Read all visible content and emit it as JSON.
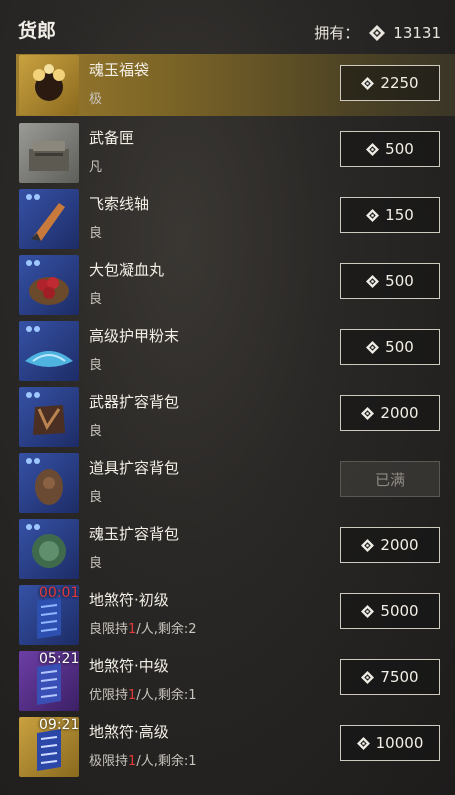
{
  "header": {
    "title": "货郎",
    "own_label": "拥有：",
    "own_amount": "13131"
  },
  "items": [
    {
      "name": "魂玉福袋",
      "quality": "极",
      "price": "2250",
      "thumb": "q-gold",
      "featured": true
    },
    {
      "name": "武备匣",
      "quality": "凡",
      "price": "500",
      "thumb": "q-grey"
    },
    {
      "name": "飞索线轴",
      "quality": "良",
      "price": "150",
      "thumb": "q-blue"
    },
    {
      "name": "大包凝血丸",
      "quality": "良",
      "price": "500",
      "thumb": "q-blue"
    },
    {
      "name": "高级护甲粉末",
      "quality": "良",
      "price": "500",
      "thumb": "q-blue"
    },
    {
      "name": "武器扩容背包",
      "quality": "良",
      "price": "2000",
      "thumb": "q-blue"
    },
    {
      "name": "道具扩容背包",
      "quality": "良",
      "price": "已满",
      "thumb": "q-blue",
      "full": true
    },
    {
      "name": "魂玉扩容背包",
      "quality": "良",
      "price": "2000",
      "thumb": "q-blue"
    },
    {
      "name": "地煞符·初级",
      "quality": "良",
      "limit_prefix": "限持",
      "limit_num": "1",
      "limit_suffix": "/人,剩余:2",
      "price": "5000",
      "thumb": "q-blue",
      "timer": "00:01",
      "timer_red": true
    },
    {
      "name": "地煞符·中级",
      "quality": "优",
      "limit_prefix": "限持",
      "limit_num": "1",
      "limit_suffix": "/人,剩余:1",
      "price": "7500",
      "thumb": "q-purple",
      "timer": "05:21"
    },
    {
      "name": "地煞符·高级",
      "quality": "极",
      "limit_prefix": "限持",
      "limit_num": "1",
      "limit_suffix": "/人,剩余:1",
      "price": "10000",
      "thumb": "q-gold",
      "timer": "09:21"
    }
  ]
}
